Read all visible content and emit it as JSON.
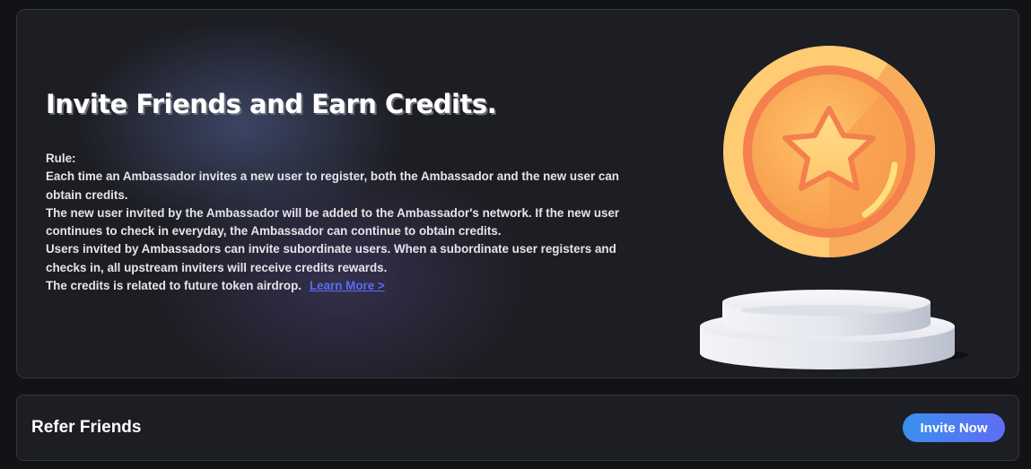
{
  "hero": {
    "title": "Invite Friends and Earn Credits.",
    "rule_label": "Rule:",
    "rules": [
      "Each time an Ambassador invites a new user to register, both the Ambassador and the new user can obtain credits.",
      "The new user invited by the Ambassador will be added to the Ambassador's network. If the new user continues to check in everyday, the Ambassador can continue to obtain credits.",
      "Users invited by Ambassadors can invite subordinate users. When a subordinate user registers and checks in, all upstream inviters will receive credits rewards.",
      "The credits is related to future token airdrop."
    ],
    "learn_more_label": "Learn More >",
    "illustration_icon": "star-coin-on-podium-icon"
  },
  "refer": {
    "title": "Refer Friends",
    "invite_label": "Invite Now"
  },
  "colors": {
    "background": "#121316",
    "panel": "#1d1e23",
    "border": "#34363d",
    "link": "#5b6cf5",
    "button_start": "#3a8ff0",
    "button_end": "#5f6df2",
    "coin": "#f9a34f"
  }
}
